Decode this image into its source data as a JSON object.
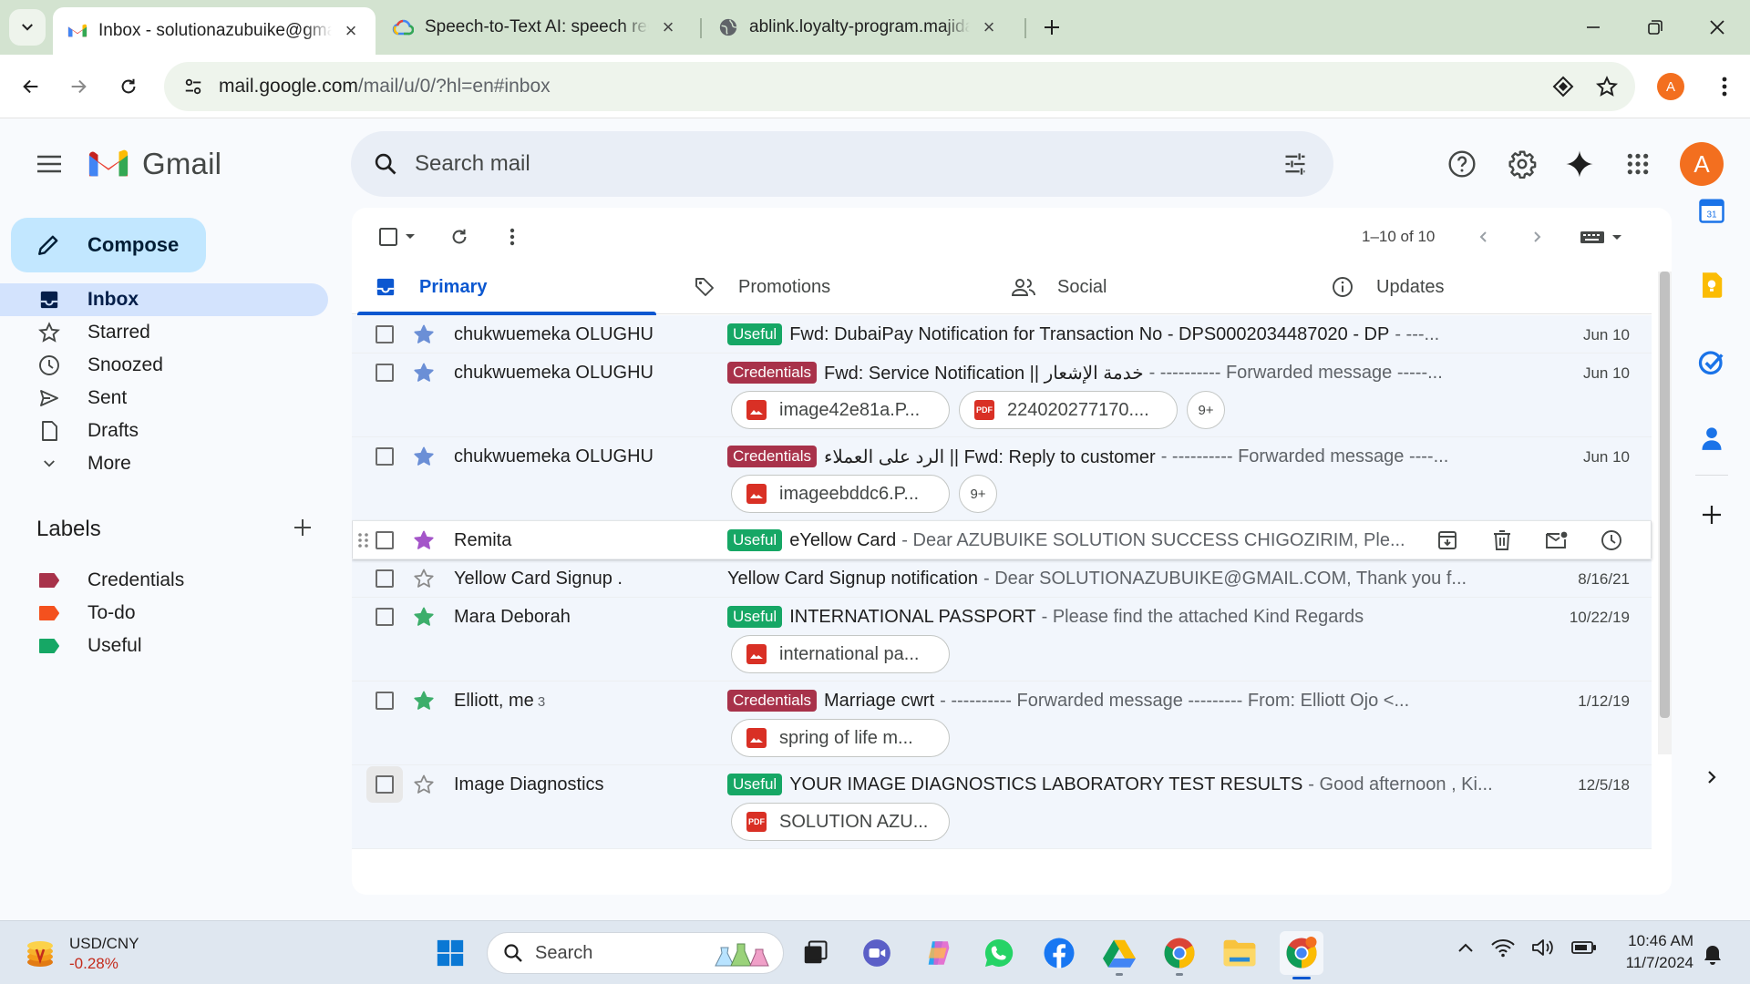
{
  "browser": {
    "tabs": [
      {
        "title": "Inbox - solutionazubuike@gmail.com - Gmail",
        "active": true,
        "icon": "gmail-icon"
      },
      {
        "title": "Speech-to-Text AI: speech recognition",
        "active": false,
        "icon": "google-cloud-icon"
      },
      {
        "title": "ablink.loyalty-program.majidalfuttaim.com",
        "active": false,
        "icon": "globe-icon"
      }
    ],
    "url_host": "mail.google.com",
    "url_path": "/mail/u/0/?hl=en#inbox",
    "profile_initial": "A"
  },
  "gmail": {
    "product_name": "Gmail",
    "search_placeholder": "Search mail",
    "account_initial": "A",
    "compose_label": "Compose",
    "nav": [
      {
        "label": "Inbox",
        "icon": "inbox-icon",
        "active": true
      },
      {
        "label": "Starred",
        "icon": "star-icon",
        "active": false
      },
      {
        "label": "Snoozed",
        "icon": "clock-icon",
        "active": false
      },
      {
        "label": "Sent",
        "icon": "send-icon",
        "active": false
      },
      {
        "label": "Drafts",
        "icon": "draft-icon",
        "active": false
      },
      {
        "label": "More",
        "icon": "chevron-down-icon",
        "active": false
      }
    ],
    "labels_heading": "Labels",
    "labels": [
      {
        "name": "Credentials",
        "color": "#a8324a"
      },
      {
        "name": "To-do",
        "color": "#f4511e"
      },
      {
        "name": "Useful",
        "color": "#16a765"
      }
    ],
    "pagination": "1–10 of 10",
    "categories": [
      {
        "label": "Primary",
        "icon": "inbox-icon",
        "active": true
      },
      {
        "label": "Promotions",
        "icon": "tag-icon",
        "active": false
      },
      {
        "label": "Social",
        "icon": "people-icon",
        "active": false
      },
      {
        "label": "Updates",
        "icon": "info-icon",
        "active": false
      }
    ],
    "emails": [
      {
        "sender": "chukwuemeka OLUGHU",
        "count": "",
        "label": "Useful",
        "subject": "Fwd: DubaiPay Notification for Transaction No - DPS0002034487020 - DP",
        "snippet": "- ---...",
        "date": "Jun 10",
        "starred": true,
        "star_color": "#6b8fd6",
        "attachments": [],
        "more": ""
      },
      {
        "sender": "chukwuemeka OLUGHU",
        "count": "",
        "label": "Credentials",
        "subject": "Fwd: Service Notification || خدمة الإشعار",
        "snippet": "- ---------- Forwarded message -----...",
        "date": "Jun 10",
        "starred": true,
        "star_color": "#6b8fd6",
        "attachments": [
          {
            "name": "image42e81a.P...",
            "type": "img"
          },
          {
            "name": "224020277170....",
            "type": "pdf"
          }
        ],
        "more": "9+"
      },
      {
        "sender": "chukwuemeka OLUGHU",
        "count": "",
        "label": "Credentials",
        "subject": "الرد على العملاء || Fwd: Reply to customer",
        "snippet": "- ---------- Forwarded message ----...",
        "date": "Jun 10",
        "starred": true,
        "star_color": "#6b8fd6",
        "attachments": [
          {
            "name": "imageebddc6.P...",
            "type": "img"
          }
        ],
        "more": "9+"
      },
      {
        "sender": "Remita",
        "count": "",
        "label": "Useful",
        "subject": "eYellow Card",
        "snippet": "- Dear AZUBUIKE SOLUTION SUCCESS CHIGOZIRIM, Ple...",
        "date": "",
        "starred": true,
        "star_color": "#a455c9",
        "attachments": [],
        "more": "",
        "hover": true
      },
      {
        "sender": "Yellow Card Signup .",
        "count": "",
        "label": "",
        "subject": "Yellow Card Signup notification",
        "snippet": "- Dear SOLUTIONAZUBUIKE@GMAIL.COM, Thank you f...",
        "date": "8/16/21",
        "starred": false,
        "star_color": "#8a8a8a",
        "attachments": [],
        "more": ""
      },
      {
        "sender": "Mara Deborah",
        "count": "",
        "label": "Useful",
        "subject": "INTERNATIONAL PASSPORT",
        "snippet": "- Please find the attached Kind Regards",
        "date": "10/22/19",
        "starred": true,
        "star_color": "#3dae6b",
        "attachments": [
          {
            "name": "international pa...",
            "type": "img"
          }
        ],
        "more": ""
      },
      {
        "sender": "Elliott, me",
        "count": "3",
        "label": "Credentials",
        "subject": "Marriage cwrt",
        "snippet": "- ---------- Forwarded message --------- From: Elliott Ojo <...",
        "date": "1/12/19",
        "starred": true,
        "star_color": "#3dae6b",
        "attachments": [
          {
            "name": "spring of life m...",
            "type": "img"
          }
        ],
        "more": ""
      },
      {
        "sender": "Image Diagnostics",
        "count": "",
        "label": "Useful",
        "subject": "YOUR IMAGE DIAGNOSTICS LABORATORY TEST RESULTS",
        "snippet": "- Good afternoon , Ki...",
        "date": "12/5/18",
        "starred": false,
        "star_color": "#8a8a8a",
        "attachments": [
          {
            "name": "SOLUTION AZU...",
            "type": "pdf"
          }
        ],
        "more": "",
        "focus": true
      }
    ]
  },
  "taskbar": {
    "ticker_name": "USD/CNY",
    "ticker_change": "-0.28%",
    "search_label": "Search",
    "time": "10:46 AM",
    "date": "11/7/2024"
  },
  "colors": {
    "accent": "#0b57d0",
    "compose_bg": "#c2e7ff",
    "nav_active": "#d3e3fd",
    "chrome_frame": "#d3e3d0"
  }
}
